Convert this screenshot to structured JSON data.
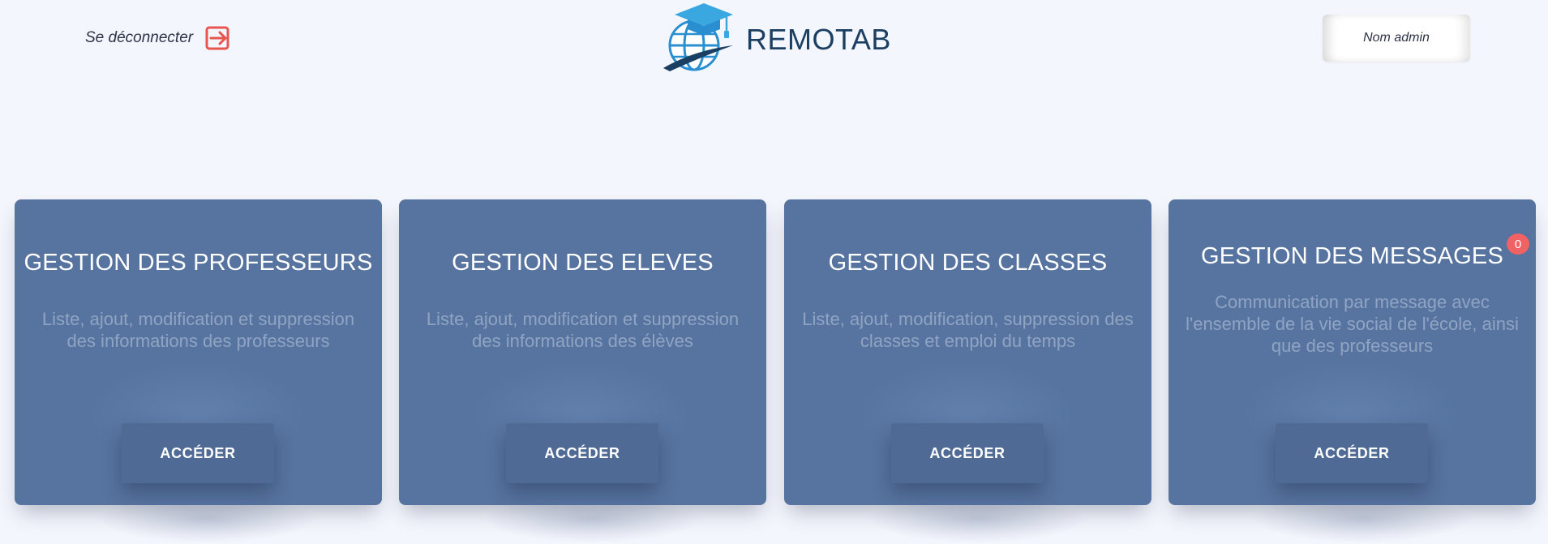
{
  "header": {
    "logout_label": "Se déconnecter",
    "logo_text": "REMOTAB",
    "admin_name": "Nom admin"
  },
  "cards": [
    {
      "title": "GESTION DES PROFESSEURS",
      "description": "Liste, ajout, modification et suppression des informations des professeurs",
      "button_label": "ACCÉDER"
    },
    {
      "title": "GESTION DES ELEVES",
      "description": "Liste, ajout, modification et suppression des informations des élèves",
      "button_label": "ACCÉDER"
    },
    {
      "title": "GESTION DES CLASSES",
      "description": "Liste, ajout, modification, suppression des classes et emploi du temps",
      "button_label": "ACCÉDER"
    },
    {
      "title": "GESTION DES MESSAGES",
      "description": "Communication par message avec l'ensemble de la vie social de l'école, ainsi que des professeurs",
      "button_label": "ACCÉDER",
      "badge_count": "0"
    }
  ],
  "icons": {
    "logout": "logout-arrow-icon",
    "logo": "globe-graduation-cap-icon"
  },
  "colors": {
    "page_background": "#f4f6fd",
    "card_background": "#5774a0",
    "button_background": "#4f6b95",
    "badge": "#f06263",
    "logout_icon": "#e8554e",
    "logo_text": "#1b3f63"
  }
}
